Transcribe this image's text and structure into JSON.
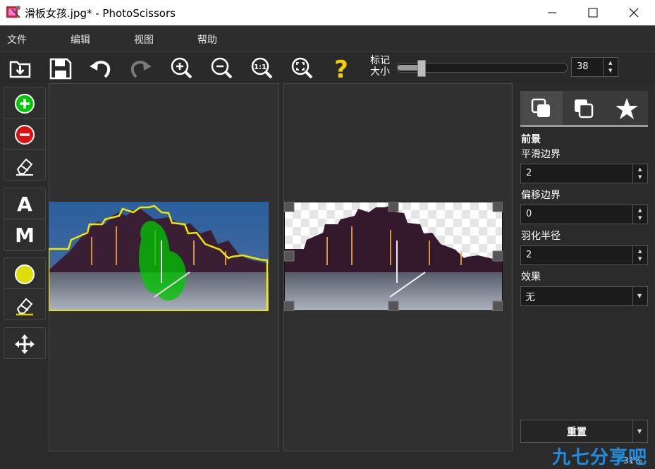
{
  "window": {
    "title": "滑板女孩.jpg* - PhotoScissors"
  },
  "menu": [
    {
      "label": "文件"
    },
    {
      "label": "编辑"
    },
    {
      "label": "视图"
    },
    {
      "label": "帮助"
    }
  ],
  "toolbar": {
    "marker_size_label": "标记大小",
    "marker_size_value": "38",
    "marker_size_fraction": 0.14
  },
  "left_tools": {
    "auto_label": "A",
    "manual_label": "M"
  },
  "right_panel": {
    "section_title": "前景",
    "smooth_edges_label": "平滑边界",
    "smooth_edges_value": "2",
    "offset_edges_label": "偏移边界",
    "offset_edges_value": "0",
    "feather_radius_label": "羽化半径",
    "feather_radius_value": "2",
    "effect_label": "效果",
    "effect_value": "无",
    "reset_label": "重置"
  },
  "status": {
    "zoom": "31%"
  },
  "watermark": "九七分享吧",
  "colors": {
    "foreground_marker": "#00c800",
    "background_marker": "#dd1111",
    "help": "#f4d000",
    "outline": "#f0e600"
  }
}
